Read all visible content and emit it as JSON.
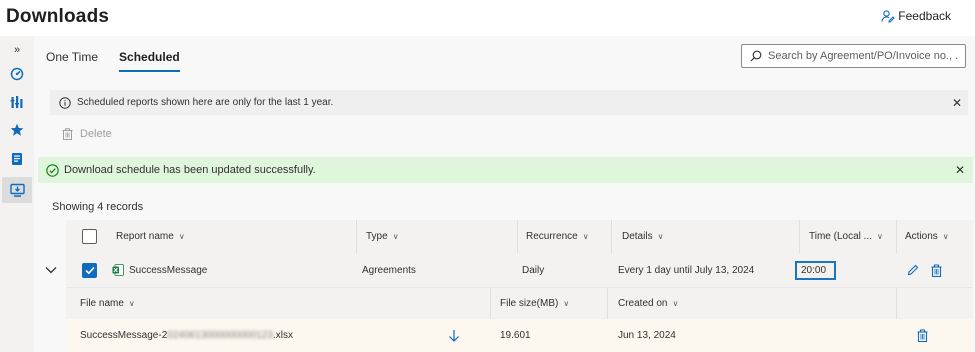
{
  "page": {
    "title": "Downloads",
    "feedback_label": "Feedback"
  },
  "leftrail": {
    "items": [
      {
        "name": "expand-nav",
        "glyph": "»"
      },
      {
        "name": "dashboard-icon"
      },
      {
        "name": "reports-icon"
      },
      {
        "name": "favorites-icon"
      },
      {
        "name": "documents-icon"
      },
      {
        "name": "downloads-icon",
        "active": true
      }
    ]
  },
  "tabs": [
    {
      "label": "One Time",
      "active": false
    },
    {
      "label": "Scheduled",
      "active": true
    }
  ],
  "search": {
    "placeholder": "Search by Agreement/PO/Invoice no., ..."
  },
  "info_bar": {
    "text": "Scheduled reports shown here are only for the last 1 year."
  },
  "toolbar": {
    "delete_label": "Delete"
  },
  "success_bar": {
    "text": "Download schedule has been updated successfully."
  },
  "records_label": "Showing 4 records",
  "table": {
    "columns": {
      "report_name": "Report name",
      "type": "Type",
      "recurrence": "Recurrence",
      "details": "Details",
      "time": "Time (Local ...",
      "actions": "Actions"
    },
    "rows": [
      {
        "report_name": "SuccessMessage",
        "type": "Agreements",
        "recurrence": "Daily",
        "details": "Every 1 day until July 13, 2024",
        "time": "20:00",
        "checked": true,
        "expanded": true,
        "files": {
          "columns": {
            "file_name": "File name",
            "file_size": "File size(MB)",
            "created_on": "Created on"
          },
          "items": [
            {
              "name_prefix": "SuccessMessage-2",
              "name_hidden": "0240613000000000123",
              "name_suffix": ".xlsx",
              "size": "19.601",
              "created": "Jun 13, 2024"
            }
          ]
        }
      }
    ]
  },
  "colors": {
    "accent": "#0f6cbd",
    "success_bg": "#dff6dd",
    "info_bg": "#efefef",
    "file_row_bg": "#fcf7ef"
  }
}
